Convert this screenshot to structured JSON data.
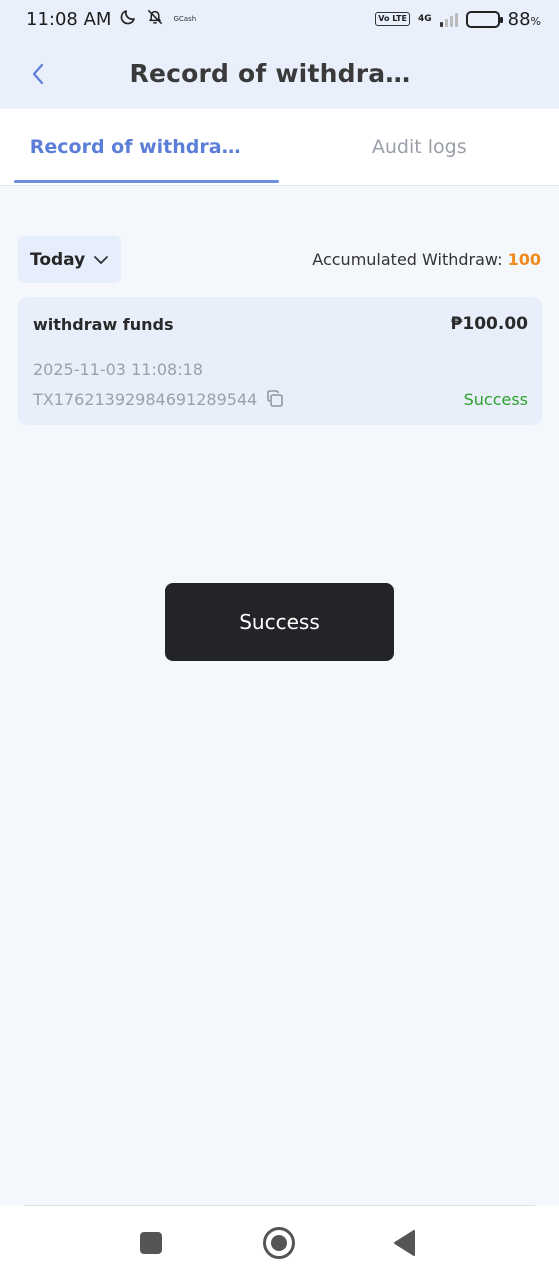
{
  "status_bar": {
    "time": "11:08 AM",
    "notification_app": "GCash",
    "volte": "Vo LTE",
    "network": "4G",
    "battery_percent": "88",
    "battery_unit": "%"
  },
  "header": {
    "title": "Record of withdrawa..."
  },
  "tabs": [
    {
      "label": "Record of withdraw...",
      "active": true
    },
    {
      "label": "Audit logs",
      "active": false
    }
  ],
  "filter": {
    "date_label": "Today",
    "accumulated_label": "Accumulated Withdraw: ",
    "accumulated_value": "100"
  },
  "records": [
    {
      "type": "withdraw funds",
      "amount": "₱100.00",
      "datetime": "2025-11-03 11:08:18",
      "transaction_id": "TX17621392984691289544",
      "status": "Success"
    }
  ],
  "toast": {
    "message": "Success"
  },
  "colors": {
    "accent_blue": "#5b7fd8",
    "header_bg": "#e9f0fb",
    "accumulated_orange": "#f08a1c",
    "success_green": "#2ea12e",
    "toast_bg": "#232427"
  },
  "icons": {
    "back": "chevron-left-icon",
    "filter": "chevron-down-icon",
    "copy": "copy-icon",
    "silent": "bell-off-icon",
    "dnd": "moon-icon"
  }
}
